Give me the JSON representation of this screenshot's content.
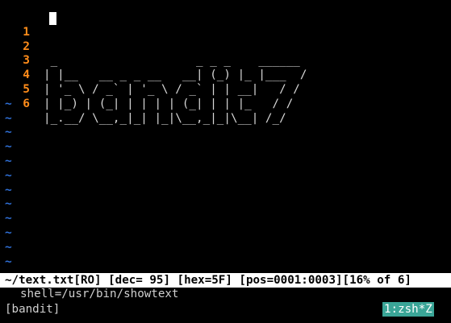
{
  "editor": {
    "lines": [
      {
        "num": "1",
        "text": ""
      },
      {
        "num": "2",
        "text": " _                    _ _ _    ______ "
      },
      {
        "num": "3",
        "text": "| |__   __ _ _ __   __| (_) |_ |___  / "
      },
      {
        "num": "4",
        "text": "| '_ \\ / _` | '_ \\ / _` | | __|   / /  "
      },
      {
        "num": "5",
        "text": "| |_) | (_| | | | | (_| | | |_   / /   "
      },
      {
        "num": "6",
        "text": "|_.__/ \\__,_|_| |_|\\__,_|_|\\__| /_/    "
      }
    ],
    "tilde": "~"
  },
  "statusline": {
    "text": "~/text.txt[RO] [dec= 95] [hex=5F] [pos=0001:0003][16% of 6]"
  },
  "cmdline": {
    "text": "shell=/usr/bin/showtext"
  },
  "tmux": {
    "session": "[bandit]",
    "window": "1:zsh*Z"
  },
  "colors": {
    "background": "#000000",
    "line_number": "#ff8c1a",
    "tilde": "#2f6fd6",
    "tmux_window_bg": "#3aa597"
  }
}
